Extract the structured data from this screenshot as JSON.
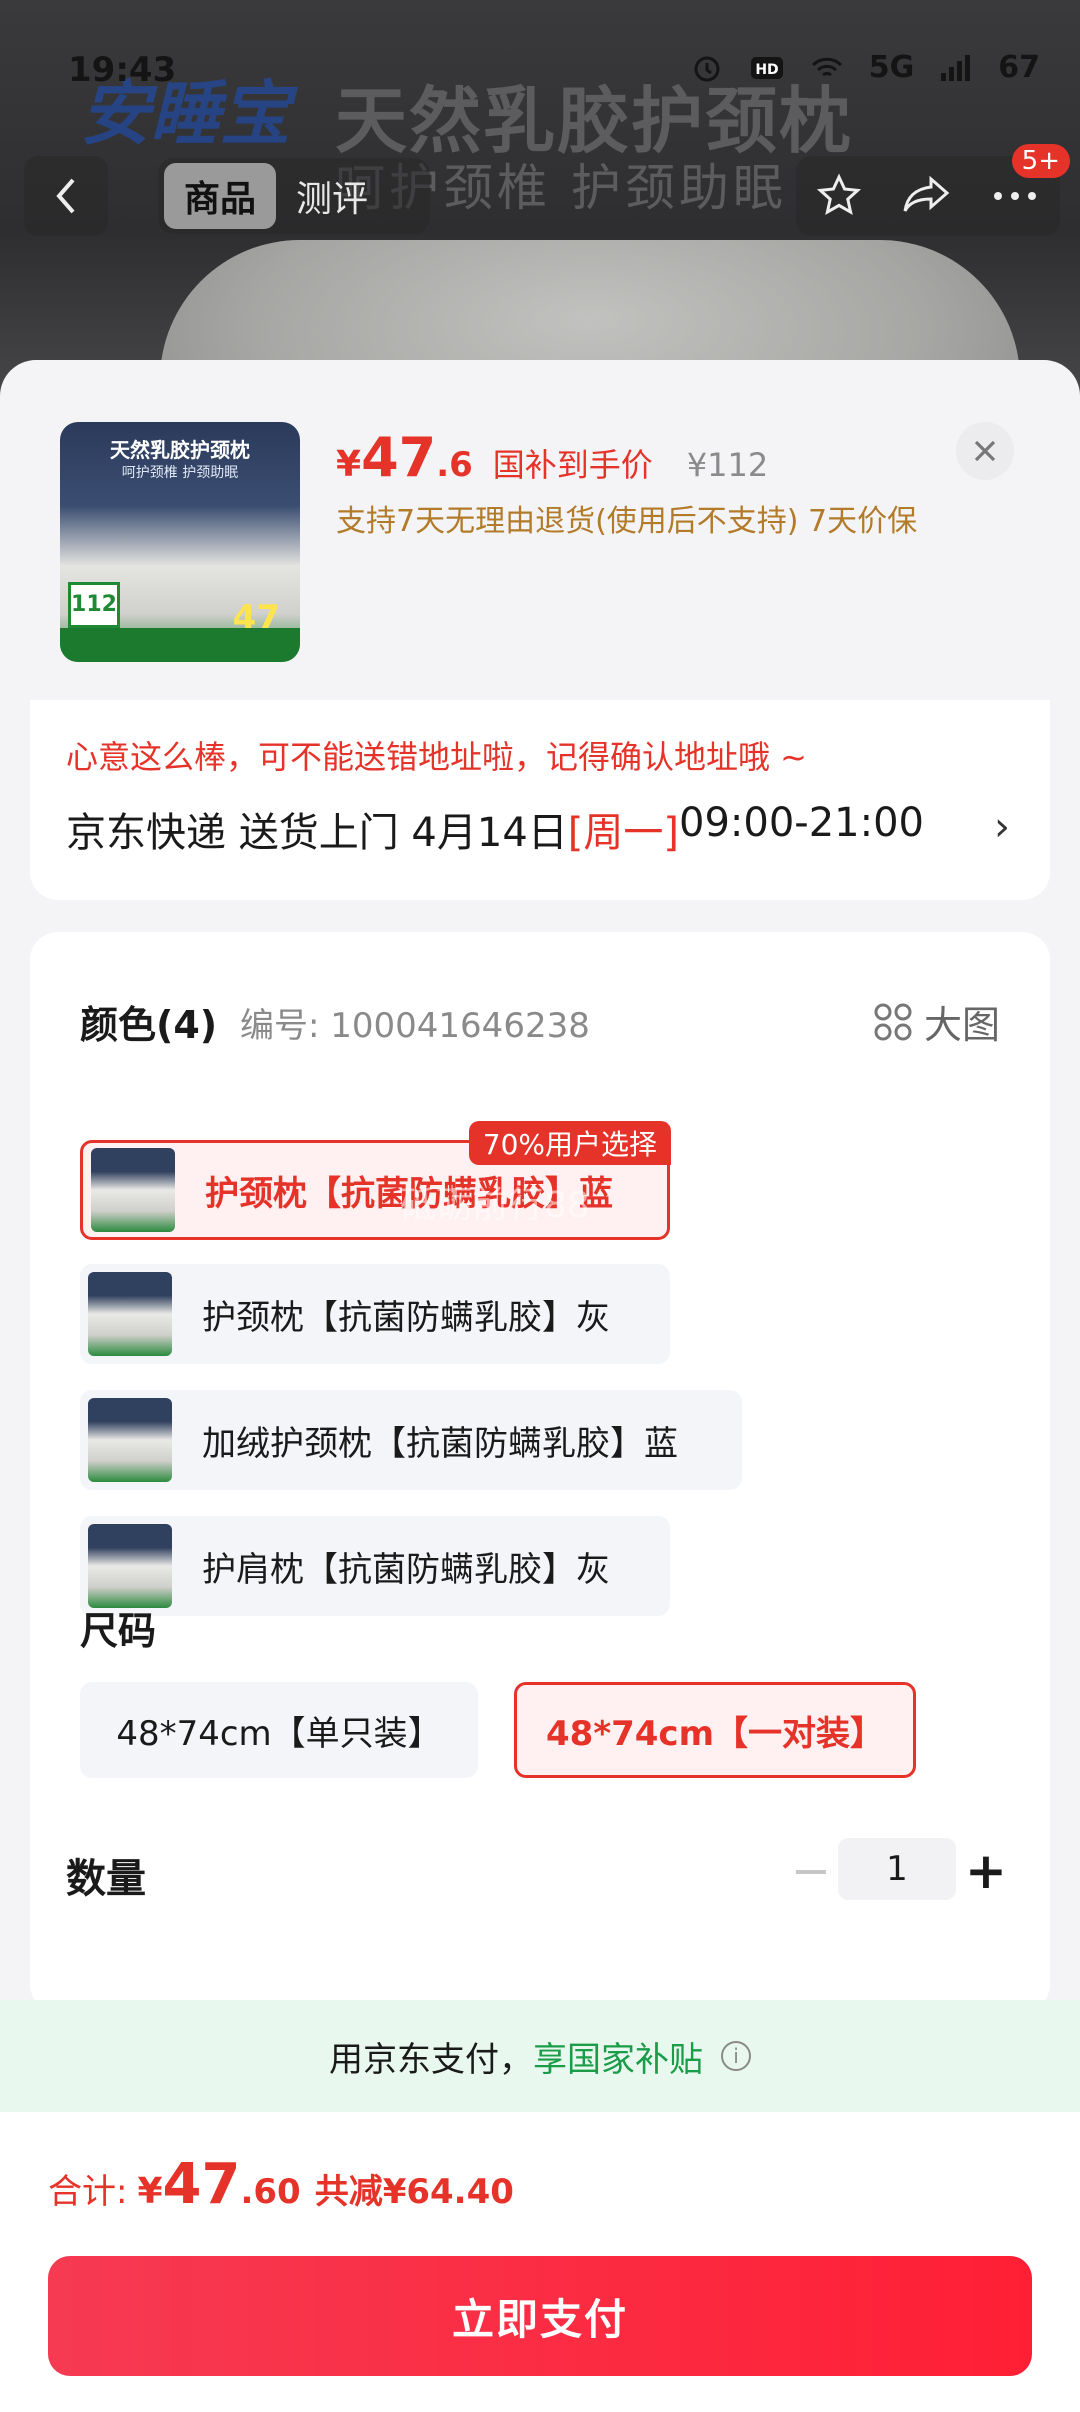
{
  "status_bar": {
    "time": "19:43",
    "network": "5G",
    "battery": "67"
  },
  "background_banner": {
    "brand": "安睡宝",
    "headline": "天然乳胶护颈枕",
    "subline": "呵护颈椎  护颈助眠"
  },
  "nav": {
    "tabs": [
      {
        "label": "商品",
        "active": true
      },
      {
        "label": "测评",
        "active": false
      }
    ],
    "badge": "5+"
  },
  "product": {
    "price_yen": "¥",
    "price_int": "47",
    "price_dec": ".6",
    "price_label": "国补到手价",
    "original_price": "¥112",
    "policy": "支持7天无理由退货(使用后不支持) 7天价保",
    "thumb": {
      "title": "天然乳胶护颈枕",
      "subtitle": "呵护颈椎 护颈助眠",
      "price_tag": "112",
      "price_tag2": "47"
    }
  },
  "address": {
    "tip": "心意这么棒，可不能送错地址啦，记得确认地址哦 ~",
    "courier": "京东快递 送货上门 4月14日 ",
    "weekday": "[周一]",
    "time_window": " 09:00-21:00"
  },
  "color_section": {
    "title": "颜色(4)",
    "code": "编号: 100041646238",
    "big_image": "大图",
    "options": [
      {
        "label": "护颈枕【抗菌防螨乳胶】蓝",
        "selected": true,
        "tag": "70%用户选择"
      },
      {
        "label": "护颈枕【抗菌防螨乳胶】灰",
        "selected": false
      },
      {
        "label": "加绒护颈枕【抗菌防螨乳胶】蓝",
        "selected": false
      },
      {
        "label": "护肩枕【抗菌防螨乳胶】灰",
        "selected": false
      }
    ],
    "watermark": "砥砺前行88"
  },
  "size_section": {
    "title": "尺码",
    "options": [
      {
        "label": "48*74cm【单只装】",
        "selected": false
      },
      {
        "label": "48*74cm【一对装】",
        "selected": true
      }
    ]
  },
  "quantity": {
    "title": "数量",
    "value": "1",
    "minus": "−",
    "plus": "+"
  },
  "pay_banner": {
    "text": "用京东支付，",
    "highlight": "享国家补贴",
    "info": "i"
  },
  "footer": {
    "total_label": "合计:",
    "total_yen": "¥",
    "total_int": "47",
    "total_dec": ".60",
    "discount": "共减¥64.40",
    "pay_button": "立即支付"
  },
  "colors": {
    "accent": "#e6332a",
    "green": "#1a9c48",
    "policy": "#b27b2a"
  }
}
